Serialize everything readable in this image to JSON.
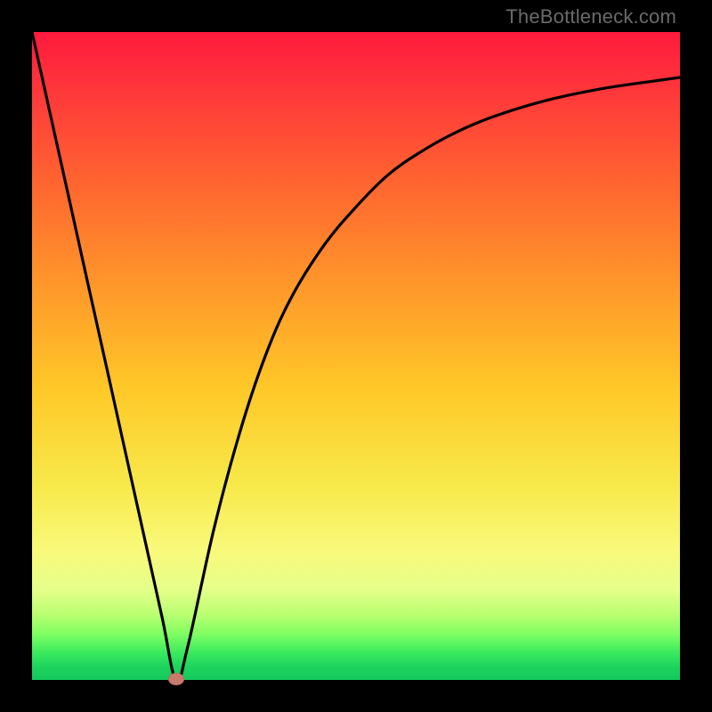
{
  "watermark": "TheBottleneck.com",
  "colors": {
    "frame": "#000000",
    "curve": "#000000",
    "dot": "#c97a6a"
  },
  "chart_data": {
    "type": "line",
    "title": "",
    "xlabel": "",
    "ylabel": "",
    "xlim": [
      0,
      100
    ],
    "ylim": [
      0,
      100
    ],
    "grid": false,
    "legend": false,
    "series": [
      {
        "name": "bottleneck-curve",
        "x": [
          0,
          4,
          8,
          12,
          16,
          20,
          22.2,
          24,
          28,
          32,
          36,
          40,
          45,
          50,
          55,
          60,
          65,
          70,
          75,
          80,
          85,
          90,
          95,
          100
        ],
        "y": [
          100,
          82,
          64,
          46,
          28,
          10,
          0,
          5,
          23,
          38,
          50,
          59,
          67,
          73,
          78,
          81.5,
          84.3,
          86.5,
          88.2,
          89.6,
          90.7,
          91.6,
          92.3,
          93
        ]
      }
    ],
    "marker": {
      "x": 22.2,
      "y": 0
    },
    "background_gradient": {
      "top": "#ff1a3d",
      "mid1": "#ff9a2a",
      "mid2": "#f7e94a",
      "bottom": "#14c85c"
    }
  }
}
